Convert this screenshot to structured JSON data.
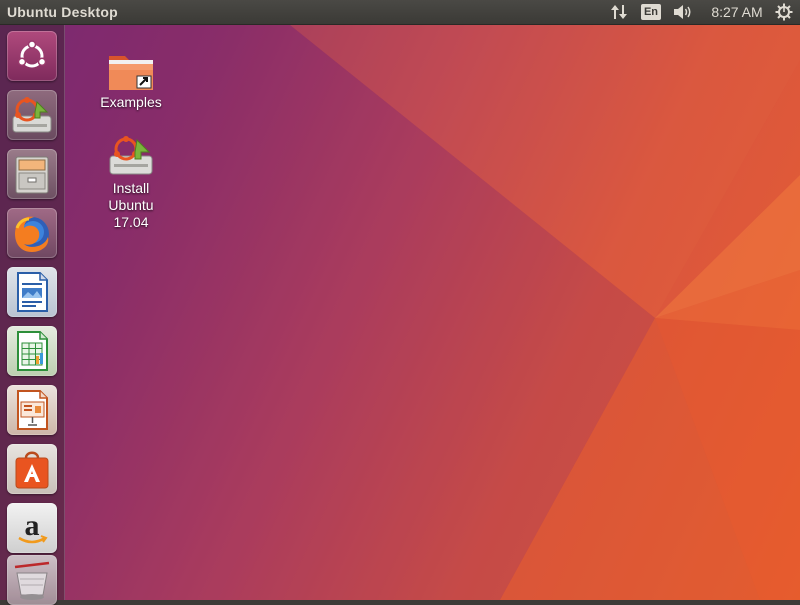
{
  "top_panel": {
    "title": "Ubuntu Desktop",
    "language": "En",
    "clock": "8:27 AM",
    "icons": [
      "network-updown-icon",
      "volume-icon",
      "power-gear-icon"
    ]
  },
  "launcher": {
    "items": [
      {
        "name": "dash-ubuntu-logo-icon"
      },
      {
        "name": "install-ubuntu-icon"
      },
      {
        "name": "files-cabinet-icon"
      },
      {
        "name": "firefox-icon"
      },
      {
        "name": "libreoffice-writer-icon"
      },
      {
        "name": "libreoffice-calc-icon"
      },
      {
        "name": "libreoffice-impress-icon"
      },
      {
        "name": "ubuntu-software-icon"
      },
      {
        "name": "amazon-icon"
      },
      {
        "name": "trash-icon"
      }
    ]
  },
  "desktop": {
    "icons": [
      {
        "label": "Examples",
        "icon": "folder-link-icon"
      },
      {
        "label": "Install Ubuntu 17.04",
        "label_lines": [
          "Install",
          "Ubuntu",
          "17.04"
        ],
        "icon": "install-ubuntu-icon"
      }
    ]
  },
  "colors": {
    "panel": "#3c3b37",
    "panel_text": "#dfdbd2",
    "wallpaper_purple": "#7b2a73",
    "wallpaper_orange": "#e8612f",
    "ubuntu_orange": "#e95420"
  }
}
